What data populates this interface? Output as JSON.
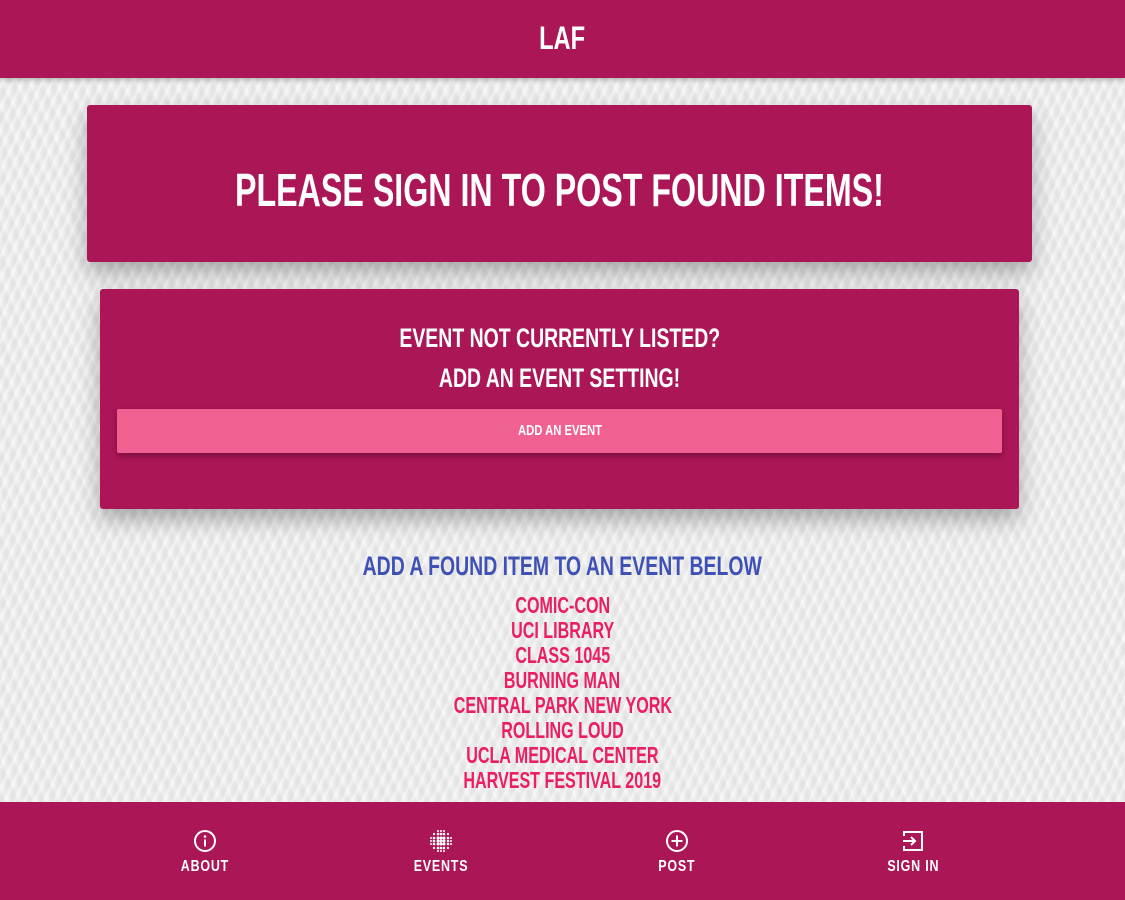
{
  "header": {
    "title": "LAF"
  },
  "banner": {
    "text": "PLEASE SIGN IN TO POST FOUND ITEMS!"
  },
  "add_event_card": {
    "line1": "EVENT NOT CURRENTLY LISTED?",
    "line2": "ADD AN EVENT SETTING!",
    "button_label": "ADD AN EVENT"
  },
  "event_list": {
    "heading": "ADD A FOUND ITEM TO AN EVENT BELOW",
    "items": [
      "COMIC-CON",
      "UCI LIBRARY",
      "CLASS 1045",
      "BURNING MAN",
      "CENTRAL PARK NEW YORK",
      "ROLLING LOUD",
      "UCLA MEDICAL CENTER",
      "HARVEST FESTIVAL 2019"
    ]
  },
  "bottom_nav": {
    "items": [
      {
        "label": "ABOUT",
        "icon": "info-icon"
      },
      {
        "label": "EVENTS",
        "icon": "dots-grid-icon"
      },
      {
        "label": "POST",
        "icon": "plus-circle-icon"
      },
      {
        "label": "SIGN IN",
        "icon": "sign-in-icon"
      }
    ]
  },
  "colors": {
    "primary": "#ab1656",
    "button": "#f06090",
    "heading_blue": "#3f51b5",
    "list_item": "#e91e63",
    "background": "#eeeeee"
  }
}
